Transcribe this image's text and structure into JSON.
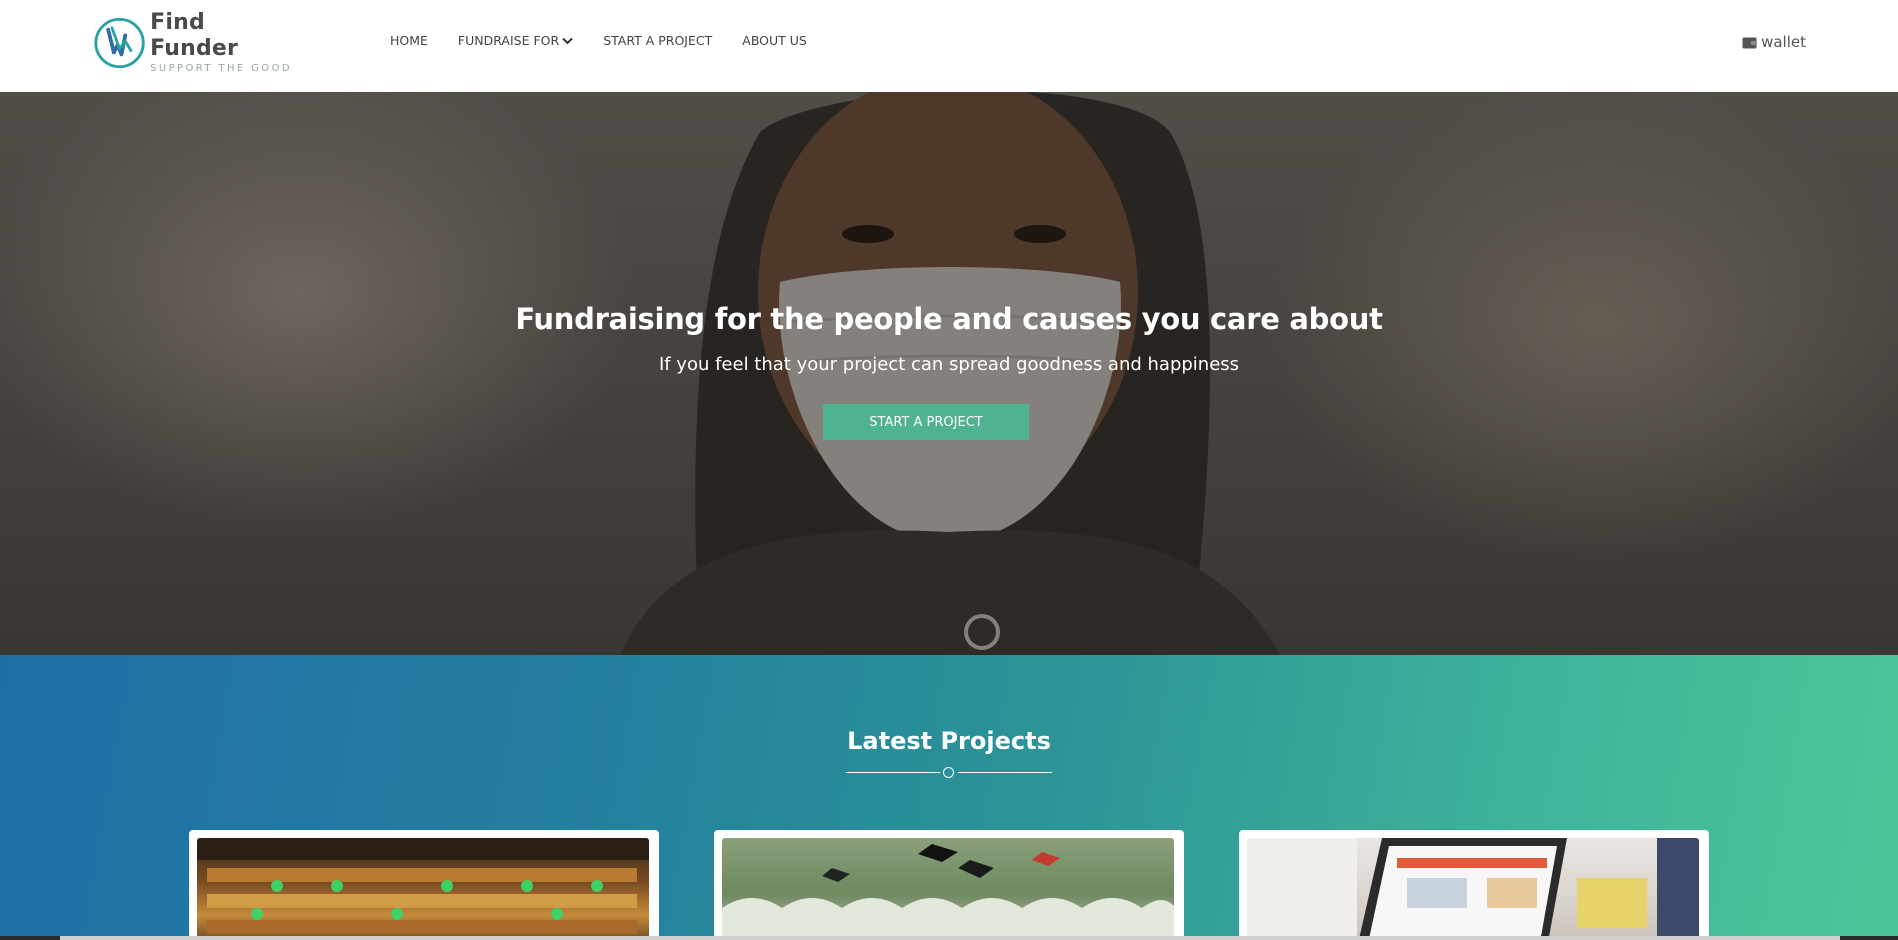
{
  "brand": {
    "name": "Find Funder",
    "tagline": "SUPPORT THE GOOD",
    "colors": {
      "primary": "#4fb391",
      "logo_teal": "#27a3a6",
      "logo_blue": "#2e6da4"
    },
    "logo_icon": "hands-circle-logo"
  },
  "nav": {
    "items": [
      {
        "label": "HOME"
      },
      {
        "label": "FUNDRAISE FOR",
        "icon": "chevron-down-icon"
      },
      {
        "label": "START A PROJECT"
      },
      {
        "label": "ABOUT US"
      }
    ],
    "wallet": {
      "label": "wallet",
      "icon": "wallet-icon"
    }
  },
  "hero": {
    "title": "Fundraising for the people and causes you care about",
    "subtitle": "If you feel that your project can spread goodness and happiness",
    "cta_label": "START A PROJECT",
    "background_image": "woman-wearing-face-mask"
  },
  "projects": {
    "title": "Latest Projects",
    "gradient": [
      "#1f6fa7",
      "#4cc698"
    ],
    "cards": [
      {
        "image": "library-reading-room-photo"
      },
      {
        "image": "graduation-caps-photo"
      },
      {
        "image": "laptop-desk-photo"
      }
    ]
  }
}
